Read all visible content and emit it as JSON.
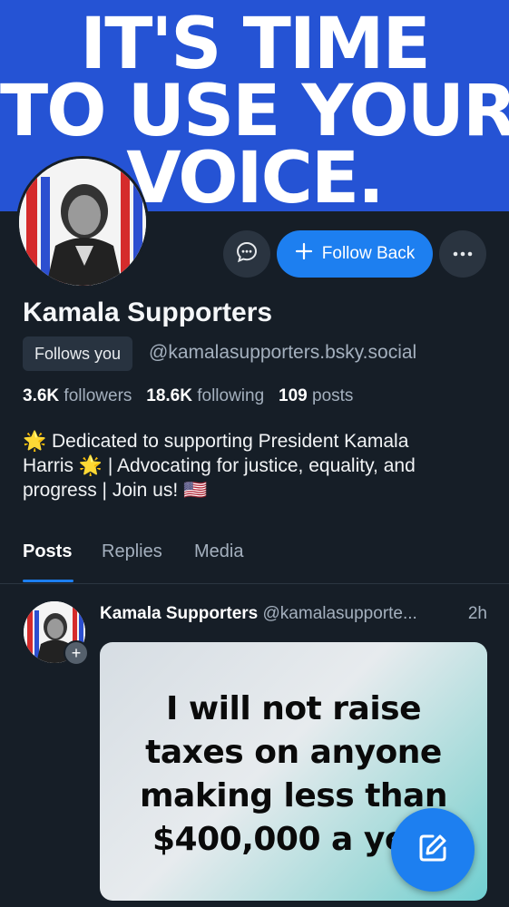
{
  "banner": {
    "line1": "IT'S TIME",
    "line2": "TO USE YOUR",
    "line3": "VOICE.",
    "color": "#2553d4"
  },
  "profile": {
    "name": "Kamala Supporters",
    "follows_you": "Follows you",
    "handle": "@kamalasupporters.bsky.social",
    "followers_count": "3.6K",
    "followers_label": "followers",
    "following_count": "18.6K",
    "following_label": "following",
    "posts_count": "109",
    "posts_label": "posts",
    "bio_line1": "🌟 Dedicated to supporting President Kamala",
    "bio_line2": "Harris 🌟 | Advocating for justice, equality, and",
    "bio_line3": "progress | Join us! 🇺🇸"
  },
  "actions": {
    "message_icon": "chat-bubble-icon",
    "follow_back_label": "Follow Back",
    "more_icon": "ellipsis-icon"
  },
  "tabs": [
    {
      "label": "Posts",
      "active": true
    },
    {
      "label": "Replies",
      "active": false
    },
    {
      "label": "Media",
      "active": false
    }
  ],
  "post": {
    "author": "Kamala Supporters",
    "handle": "@kamalasupporte...",
    "time": "2h",
    "image_line1": "I will not raise",
    "image_line2": "taxes on anyone",
    "image_line3": "making less than",
    "image_line4": "$400,000 a ye"
  },
  "fab": {
    "icon": "compose-icon"
  },
  "colors": {
    "accent": "#1d7ff0",
    "background": "#161e27",
    "muted_text": "#a4b0be"
  }
}
